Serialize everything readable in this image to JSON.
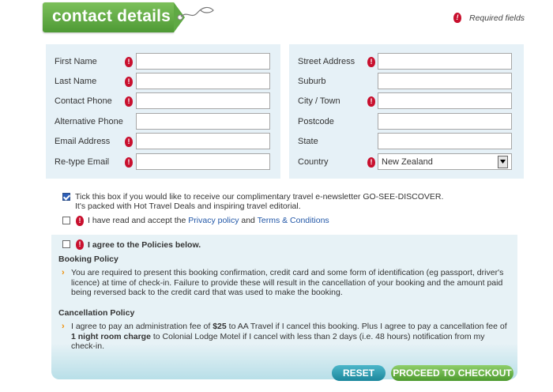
{
  "header": {
    "title": "contact details",
    "required_legend": "Required fields"
  },
  "left_fields": [
    {
      "label": "First Name",
      "required": true,
      "value": ""
    },
    {
      "label": "Last Name",
      "required": true,
      "value": ""
    },
    {
      "label": "Contact Phone",
      "required": true,
      "value": ""
    },
    {
      "label": "Alternative Phone",
      "required": false,
      "value": ""
    },
    {
      "label": "Email Address",
      "required": true,
      "value": ""
    },
    {
      "label": "Re-type Email",
      "required": true,
      "value": ""
    }
  ],
  "right_fields": [
    {
      "label": "Street Address",
      "required": true,
      "value": ""
    },
    {
      "label": "Suburb",
      "required": false,
      "value": ""
    },
    {
      "label": "City / Town",
      "required": true,
      "value": ""
    },
    {
      "label": "Postcode",
      "required": false,
      "value": ""
    },
    {
      "label": "State",
      "required": false,
      "value": ""
    },
    {
      "label": "Country",
      "required": true,
      "value": "New Zealand"
    }
  ],
  "newsletter": {
    "checked": true,
    "line1": "Tick this box if you would like to receive our complimentary travel e-newsletter GO-SEE-DISCOVER.",
    "line2": "It's packed with Hot Travel Deals and inspiring travel editorial."
  },
  "privacy": {
    "checked": false,
    "prefix": "I have read and accept the ",
    "privacy_link": "Privacy policy",
    "and": " and ",
    "terms_link": "Terms & Conditions"
  },
  "policies": {
    "agree_label": "I agree to the Policies below.",
    "booking_title": "Booking Policy",
    "booking_text": "You are required to present this booking confirmation, credit card and some form of identification (eg passport, driver's licence) at time of check-in. Failure to provide these will result in the cancellation of your booking and the amount paid being reversed back to the credit card that was used to make the booking.",
    "cancel_title": "Cancellation Policy",
    "cancel_text_1": "I agree to pay an administration fee of ",
    "cancel_fee": "$25",
    "cancel_text_2": " to AA Travel if I cancel this booking. Plus I agree to pay a cancellation fee of ",
    "cancel_charge": "1 night room charge",
    "cancel_text_3": " to Colonial Lodge Motel if I cancel with less than 2 days (i.e. 48 hours) notification from my check-in."
  },
  "buttons": {
    "reset": "RESET",
    "checkout": "PROCEED TO CHECKOUT"
  },
  "colors": {
    "brand_green": "#5fa944",
    "panel_bg": "#e6f1f7",
    "required_red": "#c8102e",
    "reset_teal": "#1b879c"
  }
}
